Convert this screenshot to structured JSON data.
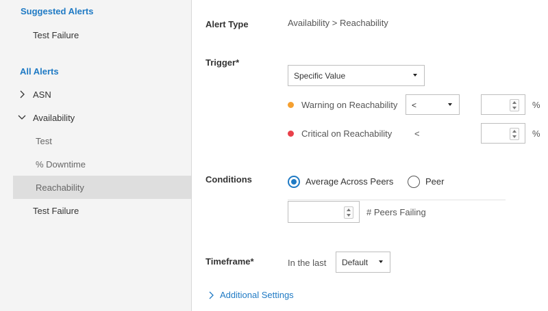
{
  "sidebar": {
    "suggested_header": "Suggested Alerts",
    "suggested_items": [
      "Test Failure"
    ],
    "all_header": "All Alerts",
    "groups": [
      {
        "label": "ASN",
        "expanded": false
      },
      {
        "label": "Availability",
        "expanded": true,
        "children": [
          "Test",
          "% Downtime",
          "Reachability"
        ]
      }
    ],
    "selected_item": "Reachability",
    "trailing_item": "Test Failure"
  },
  "form": {
    "alert_type": {
      "label": "Alert Type",
      "value": "Availability > Reachability"
    },
    "trigger": {
      "label": "Trigger*",
      "selected": "Specific Value",
      "warning": {
        "label": "Warning on Reachability",
        "operator": "<",
        "value": "",
        "unit": "%",
        "color": "#f5a030"
      },
      "critical": {
        "label": "Critical on Reachability",
        "operator": "<",
        "value": "",
        "unit": "%",
        "color": "#e9404a"
      }
    },
    "conditions": {
      "label": "Conditions",
      "options": [
        "Average Across Peers",
        "Peer"
      ],
      "selected_index": 0,
      "peers_value": "",
      "peers_label": "# Peers Failing"
    },
    "timeframe": {
      "label": "Timeframe*",
      "prefix": "In the last",
      "selected": "Default"
    },
    "additional_settings": "Additional Settings"
  },
  "colors": {
    "accent": "#1f7ac4",
    "sidebar_bg": "#f4f4f4",
    "selected_bg": "#dedede"
  }
}
